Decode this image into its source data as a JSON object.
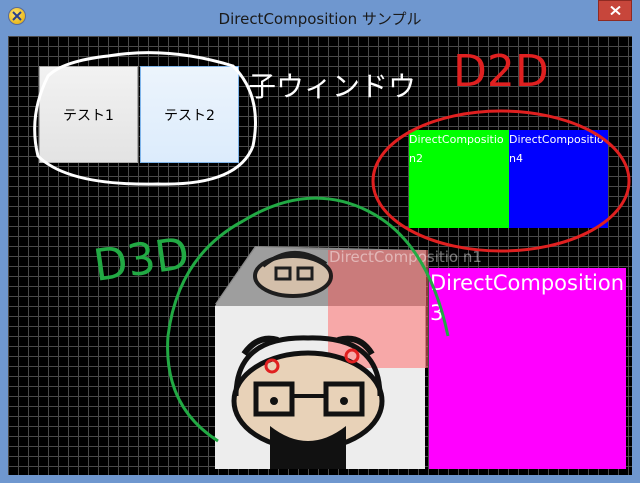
{
  "window": {
    "title": "DirectComposition サンプル"
  },
  "buttons": {
    "button1_label": "テスト1",
    "button2_label": "テスト2"
  },
  "panels": {
    "panel2_text": "DirectComposition2",
    "panel4_text": "DirectComposition4",
    "panel3_text": "DirectComposition3",
    "panel_ghost_text": "DirectCompositio n1",
    "colors": {
      "panel2": "#00ff00",
      "panel4": "#0000ff",
      "panel3": "#ff00ff",
      "overlay": "#ff6f6f"
    }
  },
  "annotations": {
    "child_window": "子ウィンドウ",
    "d2d": "D2D",
    "d3d": "D3D",
    "colors": {
      "child_window": "#ffffff",
      "d2d": "#e02020",
      "d3d": "#22aa44"
    }
  },
  "icons": {
    "app": "app-icon",
    "close": "close-icon"
  }
}
